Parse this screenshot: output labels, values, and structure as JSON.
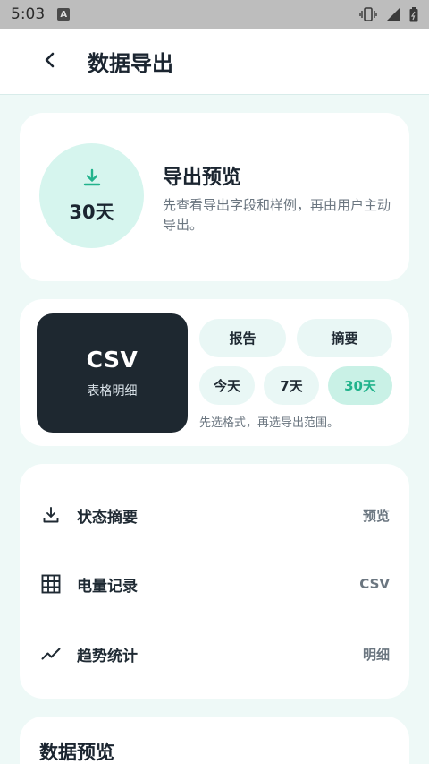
{
  "status_bar": {
    "time": "5:03",
    "notification_letter": "A",
    "icons": [
      "vibrate-icon",
      "signal-icon",
      "battery-icon"
    ]
  },
  "header": {
    "title": "数据导出",
    "back_icon": "chevron-left-icon"
  },
  "preview_card": {
    "icon": "download-icon",
    "range": "30天",
    "title": "导出预览",
    "description": "先查看导出字段和样例，再由用户主动导出。"
  },
  "format_card": {
    "selected_format": {
      "title": "CSV",
      "subtitle": "表格明细"
    },
    "formats": [
      "报告",
      "摘要"
    ],
    "ranges": [
      "今天",
      "7天",
      "30天"
    ],
    "active_range": "30天",
    "hint": "先选格式，再选导出范围。"
  },
  "fields": [
    {
      "icon": "download-icon",
      "label": "状态摘要",
      "value": "预览"
    },
    {
      "icon": "grid-icon",
      "label": "电量记录",
      "value": "CSV"
    },
    {
      "icon": "trend-icon",
      "label": "趋势统计",
      "value": "明细"
    }
  ],
  "data_preview": {
    "title": "数据预览"
  },
  "colors": {
    "accent": "#22b38c",
    "accent_bg": "#c9f1e6",
    "dark": "#1e2830",
    "page_bg": "#eef9f7"
  }
}
